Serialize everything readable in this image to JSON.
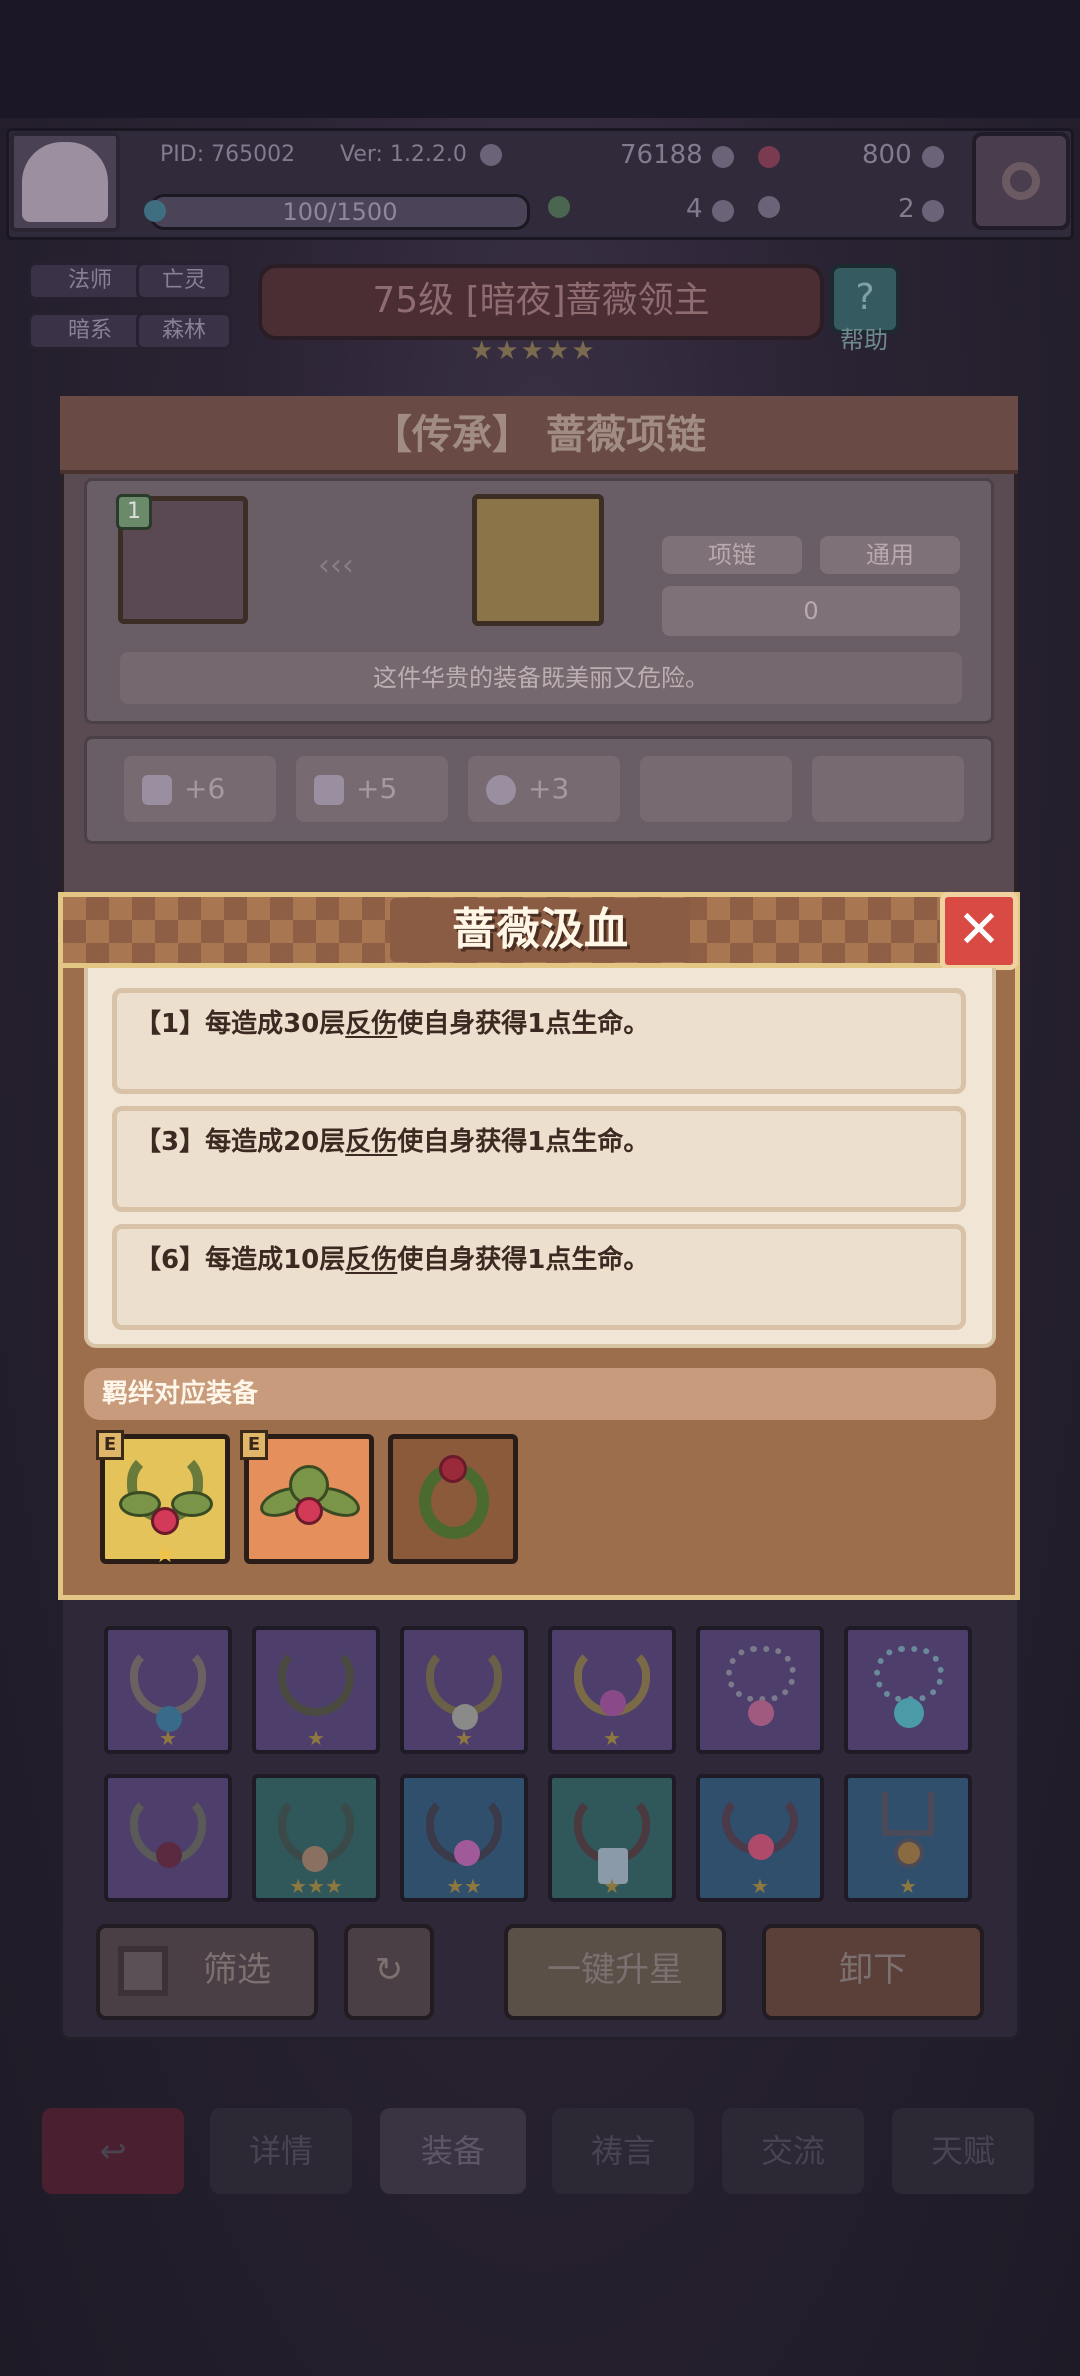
{
  "hud": {
    "pid": "PID: 765002",
    "version": "Ver: 1.2.2.0",
    "gold": "76188",
    "gems": "800",
    "stamina": "100/1500",
    "clover": "4",
    "music": "2"
  },
  "tags": [
    "法师",
    "亡灵",
    "暗系",
    "森林"
  ],
  "boss": {
    "title": "75级 [暗夜]蔷薇领主",
    "stars": "★★★★★",
    "help_label": "帮助"
  },
  "item_panel": {
    "title": "【传承】 蔷薇项链",
    "hero_level": "1",
    "type_label": "项链",
    "class_label": "通用",
    "count_value": "0",
    "description": "这件华贵的装备既美丽又危险。",
    "stats": [
      {
        "icon": "book-icon",
        "value": "+6"
      },
      {
        "icon": "scroll-icon",
        "value": "+5"
      },
      {
        "icon": "heart-icon",
        "value": "+3"
      }
    ]
  },
  "modal": {
    "title": "蔷薇汲血",
    "effects": [
      {
        "tier": "【1】",
        "pre": "每造成30层",
        "keyword": "反伤",
        "post": "使自身获得1点生命。"
      },
      {
        "tier": "【3】",
        "pre": "每造成20层",
        "keyword": "反伤",
        "post": "使自身获得1点生命。"
      },
      {
        "tier": "【6】",
        "pre": "每造成10层",
        "keyword": "反伤",
        "post": "使自身获得1点生命。"
      }
    ],
    "bond_label": "羁绊对应装备",
    "bond_items": [
      {
        "badge": "E",
        "star": "★"
      },
      {
        "badge": "E",
        "star": ""
      },
      {
        "badge": "",
        "star": ""
      }
    ]
  },
  "actions": {
    "filter": "筛选",
    "upgrade_all": "一键升星",
    "unequip": "卸下"
  },
  "bottom_nav": [
    "详情",
    "装备",
    "祷言",
    "交流",
    "天赋"
  ],
  "colors": {
    "modal_border": "#e3c584",
    "close_red": "#d94a44",
    "effect_text": "#3c2a22"
  }
}
